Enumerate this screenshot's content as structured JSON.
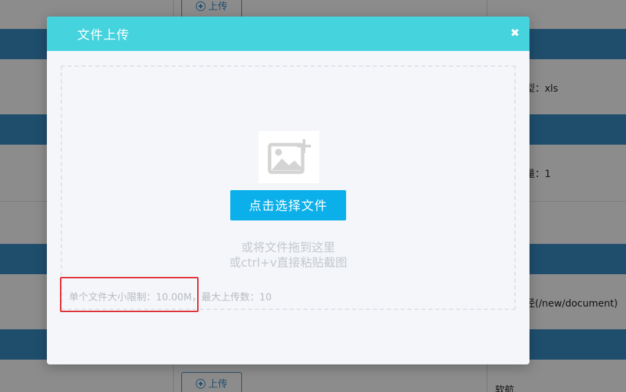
{
  "background": {
    "upload_label": "上传",
    "text_xls": "型：xls",
    "text_count": "量：1",
    "text_path": "径(/new/document)",
    "text_soft": "软航"
  },
  "modal": {
    "title": "文件上传",
    "close_icon": "close-icon",
    "select_button_label": "点击选择文件",
    "hint_line1": "或将文件拖到这里",
    "hint_line2": "或ctrl+v直接粘贴截图",
    "limit_text": "单个文件大小限制：10.00M，最大上传数：10",
    "placeholder_icon": "image-add-icon"
  },
  "colors": {
    "header": "#45d3de",
    "button": "#0bb0ea",
    "highlight": "#e0252b"
  }
}
